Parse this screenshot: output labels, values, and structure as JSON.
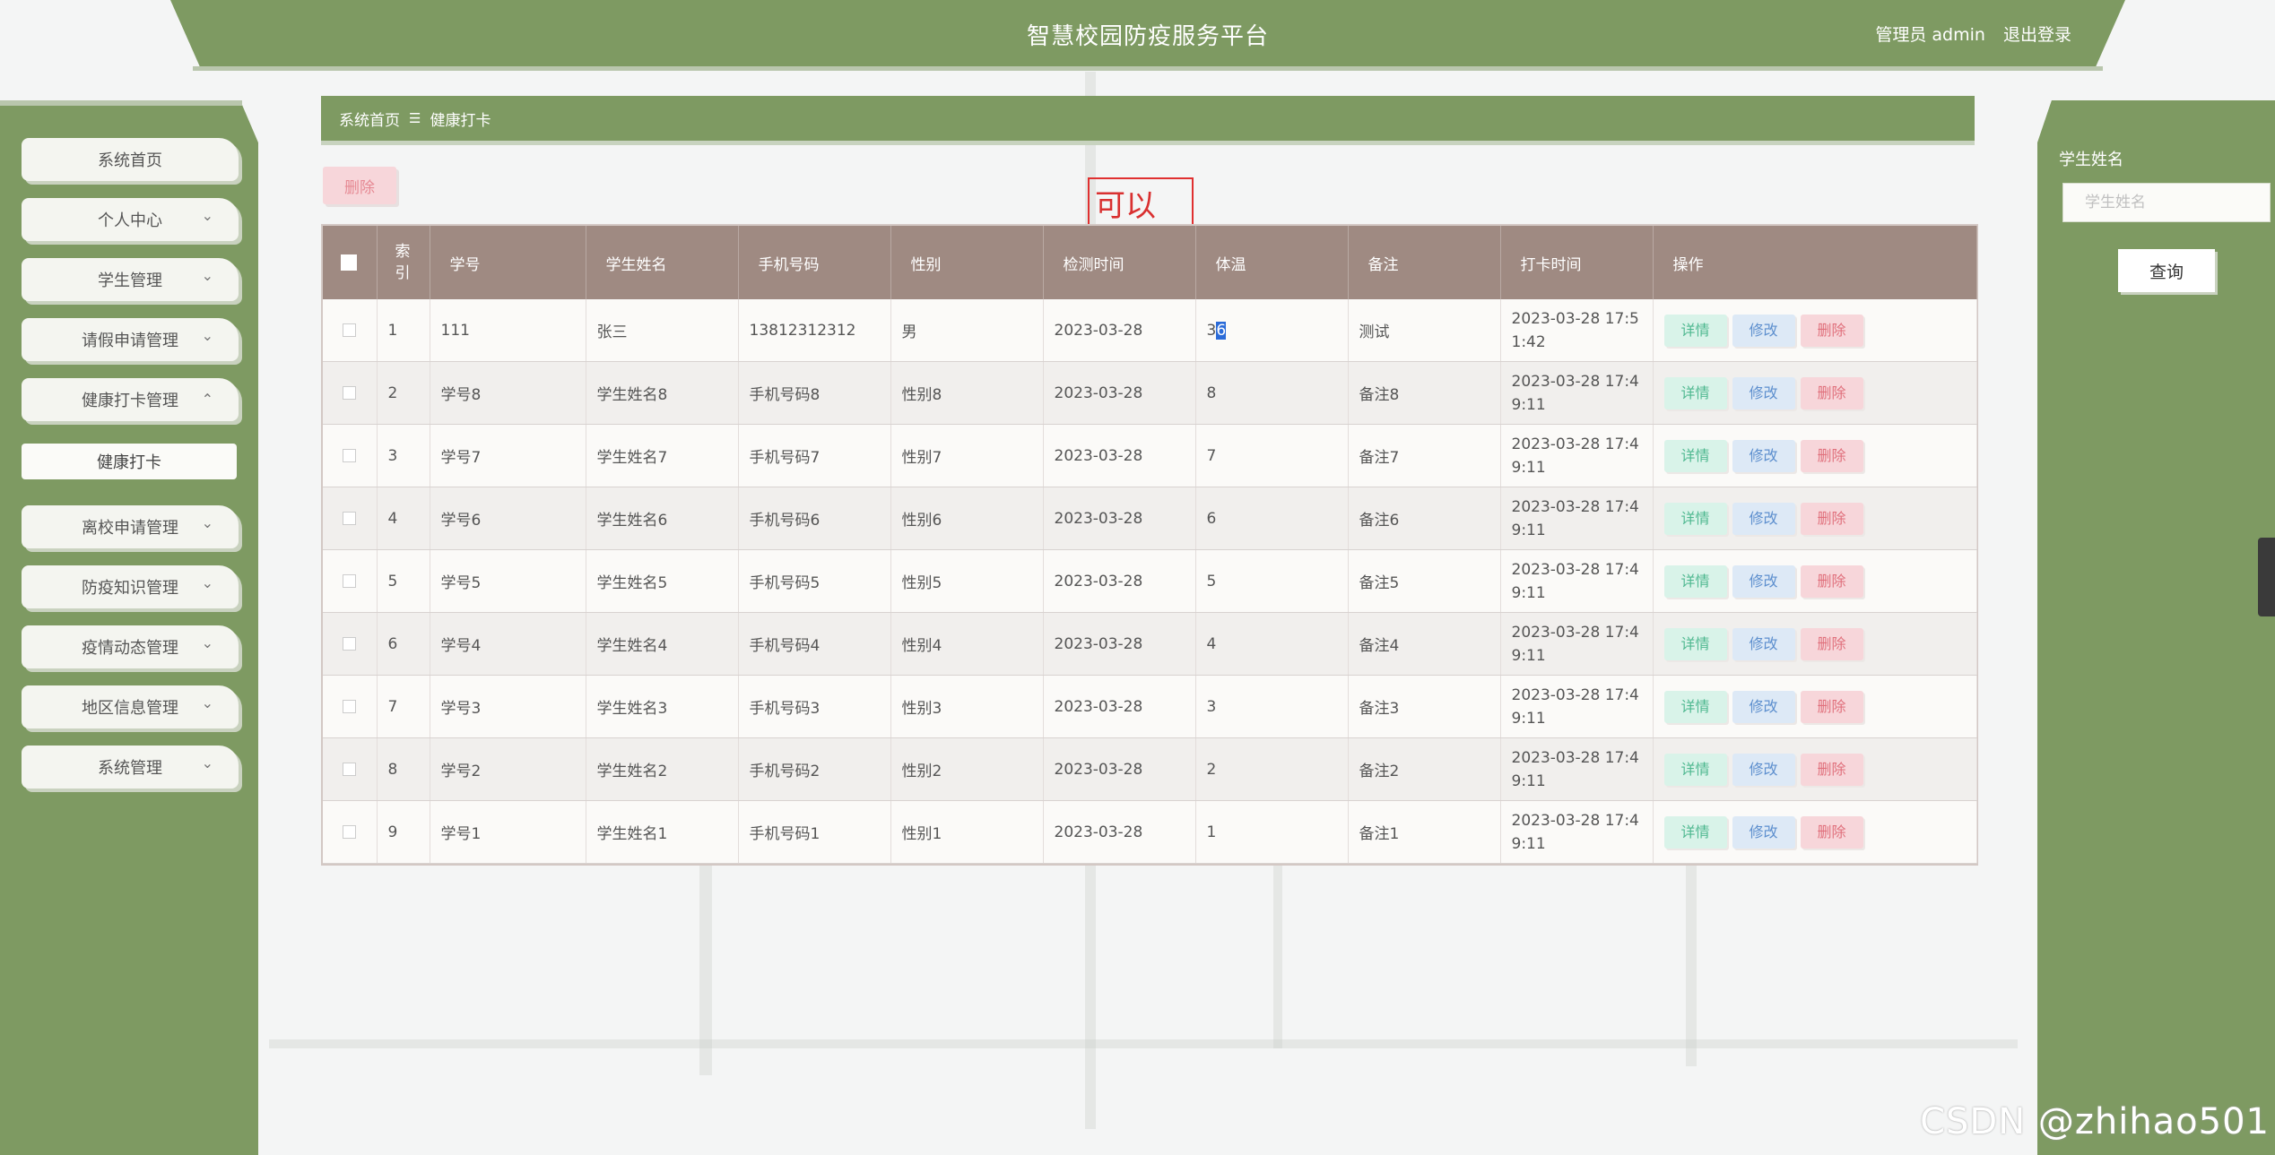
{
  "header": {
    "title": "智慧校园防疫服务平台",
    "admin_label": "管理员 admin",
    "logout_label": "退出登录"
  },
  "sidebar": {
    "items": [
      {
        "label": "系统首页",
        "expandable": false
      },
      {
        "label": "个人中心",
        "expandable": true,
        "state": "collapsed"
      },
      {
        "label": "学生管理",
        "expandable": true,
        "state": "collapsed"
      },
      {
        "label": "请假申请管理",
        "expandable": true,
        "state": "collapsed"
      },
      {
        "label": "健康打卡管理",
        "expandable": true,
        "state": "expanded"
      },
      {
        "label": "离校申请管理",
        "expandable": true,
        "state": "collapsed"
      },
      {
        "label": "防疫知识管理",
        "expandable": true,
        "state": "collapsed"
      },
      {
        "label": "疫情动态管理",
        "expandable": true,
        "state": "collapsed"
      },
      {
        "label": "地区信息管理",
        "expandable": true,
        "state": "collapsed"
      },
      {
        "label": "系统管理",
        "expandable": true,
        "state": "collapsed"
      }
    ],
    "subitem": {
      "label": "健康打卡"
    }
  },
  "breadcrumb": {
    "home": "系统首页",
    "separator": "☰",
    "current": "健康打卡"
  },
  "toolbar": {
    "delete_label": "删除"
  },
  "annotation": {
    "text": "可以"
  },
  "table": {
    "headers": [
      "索引",
      "学号",
      "学生姓名",
      "手机号码",
      "性别",
      "检测时间",
      "体温",
      "备注",
      "打卡时间",
      "操作"
    ],
    "index_header_line1": "索",
    "index_header_line2": "引",
    "rows": [
      {
        "idx": "1",
        "id": "111",
        "name": "张三",
        "phone": "13812312312",
        "gender": "男",
        "check_date": "2023-03-28",
        "temp_a": "3",
        "temp_b": "6",
        "note": "测试",
        "time1": "2023-03-28 17:5",
        "time2": "1:42"
      },
      {
        "idx": "2",
        "id": "学号8",
        "name": "学生姓名8",
        "phone": "手机号码8",
        "gender": "性别8",
        "check_date": "2023-03-28",
        "temp": "8",
        "note": "备注8",
        "time1": "2023-03-28 17:4",
        "time2": "9:11"
      },
      {
        "idx": "3",
        "id": "学号7",
        "name": "学生姓名7",
        "phone": "手机号码7",
        "gender": "性别7",
        "check_date": "2023-03-28",
        "temp": "7",
        "note": "备注7",
        "time1": "2023-03-28 17:4",
        "time2": "9:11"
      },
      {
        "idx": "4",
        "id": "学号6",
        "name": "学生姓名6",
        "phone": "手机号码6",
        "gender": "性别6",
        "check_date": "2023-03-28",
        "temp": "6",
        "note": "备注6",
        "time1": "2023-03-28 17:4",
        "time2": "9:11"
      },
      {
        "idx": "5",
        "id": "学号5",
        "name": "学生姓名5",
        "phone": "手机号码5",
        "gender": "性别5",
        "check_date": "2023-03-28",
        "temp": "5",
        "note": "备注5",
        "time1": "2023-03-28 17:4",
        "time2": "9:11"
      },
      {
        "idx": "6",
        "id": "学号4",
        "name": "学生姓名4",
        "phone": "手机号码4",
        "gender": "性别4",
        "check_date": "2023-03-28",
        "temp": "4",
        "note": "备注4",
        "time1": "2023-03-28 17:4",
        "time2": "9:11"
      },
      {
        "idx": "7",
        "id": "学号3",
        "name": "学生姓名3",
        "phone": "手机号码3",
        "gender": "性别3",
        "check_date": "2023-03-28",
        "temp": "3",
        "note": "备注3",
        "time1": "2023-03-28 17:4",
        "time2": "9:11"
      },
      {
        "idx": "8",
        "id": "学号2",
        "name": "学生姓名2",
        "phone": "手机号码2",
        "gender": "性别2",
        "check_date": "2023-03-28",
        "temp": "2",
        "note": "备注2",
        "time1": "2023-03-28 17:4",
        "time2": "9:11"
      },
      {
        "idx": "9",
        "id": "学号1",
        "name": "学生姓名1",
        "phone": "手机号码1",
        "gender": "性别1",
        "check_date": "2023-03-28",
        "temp": "1",
        "note": "备注1",
        "time1": "2023-03-28 17:4",
        "time2": "9:11"
      }
    ],
    "actions": {
      "detail": "详情",
      "edit": "修改",
      "delete": "删除"
    }
  },
  "search": {
    "label": "学生姓名",
    "placeholder": "学生姓名",
    "button": "查询"
  },
  "watermark": "CSDN @zhihao501",
  "colors": {
    "primary": "#7e9a62",
    "table_header": "#9f8a82",
    "danger": "#e0707c",
    "success": "#4fb890",
    "info": "#5d8fce",
    "annotation": "#e03030"
  }
}
